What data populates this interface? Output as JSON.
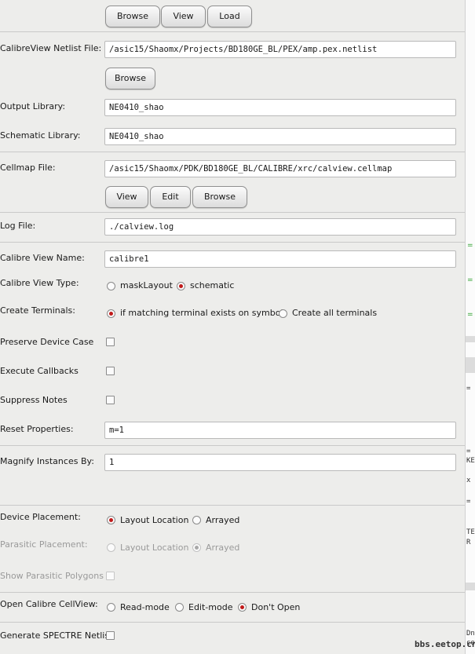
{
  "top_buttons": {
    "browse": "Browse",
    "view": "View",
    "load": "Load"
  },
  "netlist": {
    "label": "CalibreView Netlist File:",
    "value": "/asic15/Shaomx/Projects/BD180GE_BL/PEX/amp.pex.netlist",
    "browse": "Browse"
  },
  "output_library": {
    "label": "Output Library:",
    "value": "NE0410_shao"
  },
  "schematic_library": {
    "label": "Schematic Library:",
    "value": "NE0410_shao"
  },
  "cellmap": {
    "label": "Cellmap File:",
    "value": "/asic15/Shaomx/PDK/BD180GE_BL/CALIBRE/xrc/calview.cellmap",
    "view": "View",
    "edit": "Edit",
    "browse": "Browse"
  },
  "log_file": {
    "label": "Log File:",
    "value": "./calview.log"
  },
  "view_name": {
    "label": "Calibre View Name:",
    "value": "calibre1"
  },
  "view_type": {
    "label": "Calibre View Type:",
    "options": [
      "maskLayout",
      "schematic"
    ],
    "selected": "schematic"
  },
  "create_terminals": {
    "label": "Create Terminals:",
    "options": [
      "if matching terminal exists on symbol",
      "Create all terminals"
    ],
    "selected": "if matching terminal exists on symbol"
  },
  "preserve_device_case": {
    "label": "Preserve Device Case",
    "checked": false
  },
  "execute_callbacks": {
    "label": "Execute Callbacks",
    "checked": false
  },
  "suppress_notes": {
    "label": "Suppress Notes",
    "checked": false
  },
  "reset_properties": {
    "label": "Reset Properties:",
    "value": "m=1"
  },
  "magnify": {
    "label": "Magnify Instances By:",
    "value": "1"
  },
  "device_placement": {
    "label": "Device Placement:",
    "options": [
      "Layout Location",
      "Arrayed"
    ],
    "selected": "Layout Location"
  },
  "parasitic_placement": {
    "label": "Parasitic Placement:",
    "options": [
      "Layout Location",
      "Arrayed"
    ],
    "selected": "Arrayed",
    "disabled": true
  },
  "show_parasitic_polygons": {
    "label": "Show Parasitic Polygons",
    "checked": false,
    "disabled": true
  },
  "open_cellview": {
    "label": "Open Calibre CellView:",
    "options": [
      "Read-mode",
      "Edit-mode",
      "Don't Open"
    ],
    "selected": "Don't Open"
  },
  "generate_spectre": {
    "label": "Generate SPECTRE Netlist",
    "checked": false
  },
  "background_pane": {
    "fragments": [
      "=",
      "=",
      "KE",
      "x",
      "=",
      "TE",
      "R",
      "Dn",
      "ce"
    ]
  },
  "watermark": "bbs.eetop.cn",
  "colors": {
    "radio_selected": "#c01a1a",
    "window_bg": "#ededeb"
  }
}
